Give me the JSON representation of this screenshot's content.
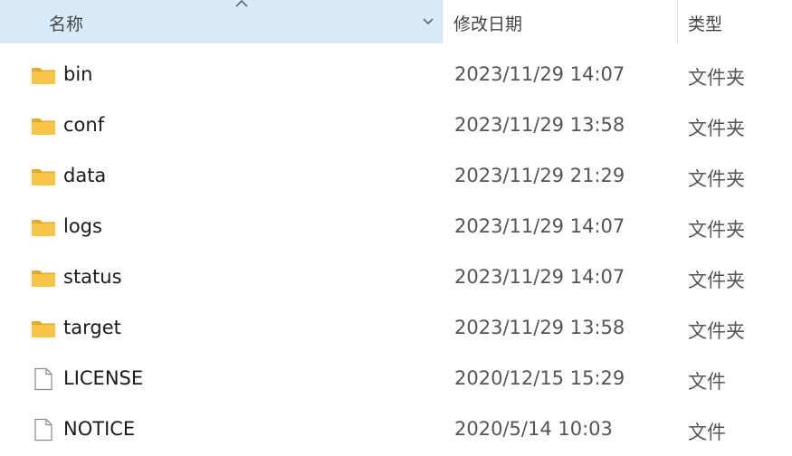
{
  "columns": {
    "name": "名称",
    "date": "修改日期",
    "type": "类型"
  },
  "colors": {
    "header_selected_bg": "#d9ebf9",
    "folder_yellow": "#f8c74a",
    "folder_dark": "#e8a925"
  },
  "files": [
    {
      "name": "bin",
      "date": "2023/11/29 14:07",
      "type": "文件夹",
      "icon": "folder-icon"
    },
    {
      "name": "conf",
      "date": "2023/11/29 13:58",
      "type": "文件夹",
      "icon": "folder-icon"
    },
    {
      "name": "data",
      "date": "2023/11/29 21:29",
      "type": "文件夹",
      "icon": "folder-icon"
    },
    {
      "name": "logs",
      "date": "2023/11/29 14:07",
      "type": "文件夹",
      "icon": "folder-icon"
    },
    {
      "name": "status",
      "date": "2023/11/29 14:07",
      "type": "文件夹",
      "icon": "folder-icon"
    },
    {
      "name": "target",
      "date": "2023/11/29 13:58",
      "type": "文件夹",
      "icon": "folder-icon"
    },
    {
      "name": "LICENSE",
      "date": "2020/12/15 15:29",
      "type": "文件",
      "icon": "file-icon"
    },
    {
      "name": "NOTICE",
      "date": "2020/5/14 10:03",
      "type": "文件",
      "icon": "file-icon"
    }
  ]
}
